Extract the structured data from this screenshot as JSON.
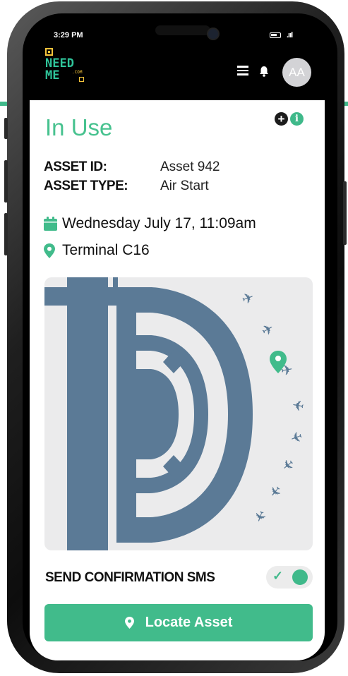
{
  "status_bar": {
    "time": "3:29 PM",
    "signal": ".ııl"
  },
  "brand": {
    "line1": "NEED",
    "line2": "ME",
    "suffix": ".COM"
  },
  "header": {
    "avatar_initials": "AA"
  },
  "page": {
    "title": "In Use"
  },
  "asset": {
    "id_label": "ASSET ID:",
    "id_value": "Asset 942",
    "type_label": "ASSET TYPE:",
    "type_value": "Air Start"
  },
  "schedule": {
    "date": "Wednesday July 17, 11:09am"
  },
  "location": {
    "terminal": "Terminal C16"
  },
  "sms": {
    "label": "SEND CONFIRMATION SMS",
    "enabled": true,
    "check": "✓"
  },
  "actions": {
    "locate_label": "Locate Asset"
  },
  "colors": {
    "accent": "#41bb8b",
    "brand_yellow": "#f5c33b",
    "map_building": "#5b7a96",
    "map_background": "#ebebec"
  },
  "icons": {
    "menu": "hamburger-icon",
    "bell": "bell-icon",
    "add": "plus-circle-icon",
    "info": "info-circle-icon",
    "calendar": "calendar-icon",
    "pin": "map-pin-icon",
    "plane": "airplane-icon"
  }
}
